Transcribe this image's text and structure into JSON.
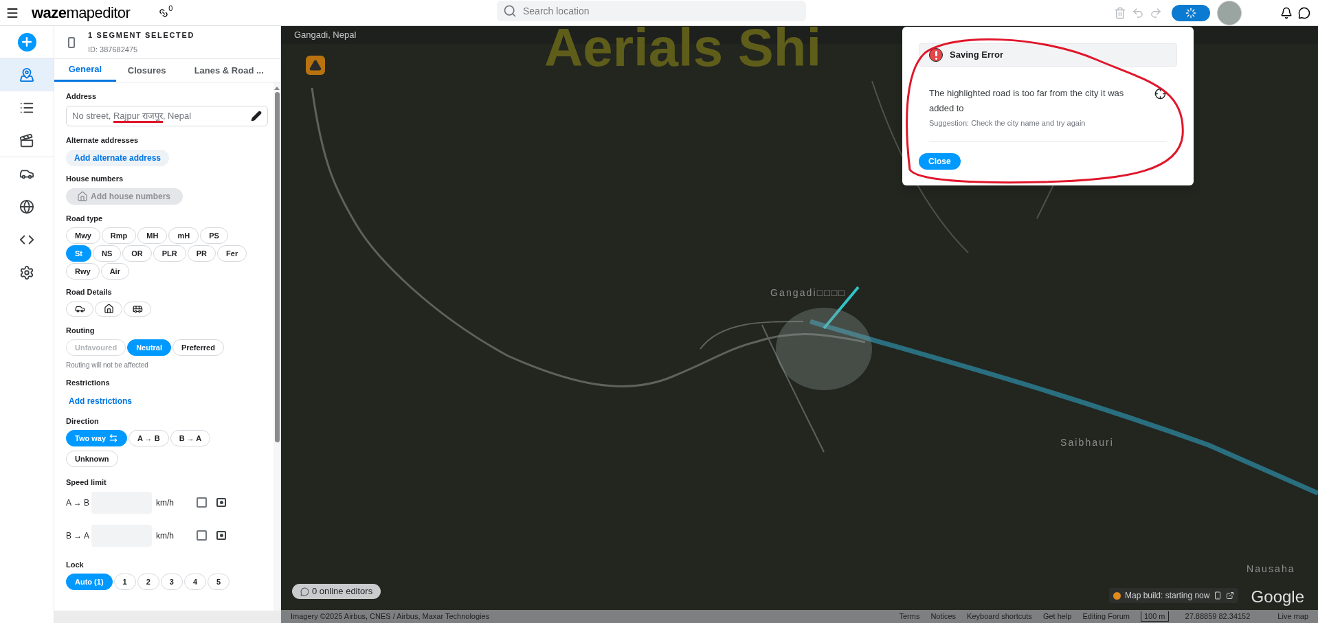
{
  "topbar": {
    "logo_bold": "waze",
    "logo_light": "mapeditor",
    "connections_count": "0",
    "search": {
      "placeholder": "Search location"
    },
    "undo_disabled": true,
    "redo_disabled": true,
    "saving": true
  },
  "rail": [
    {
      "kind": "add",
      "selected": false
    },
    {
      "kind": "edit",
      "selected": true
    },
    {
      "kind": "list",
      "selected": false
    },
    {
      "kind": "events",
      "selected": false
    },
    {
      "kind": "car",
      "selected": false
    },
    {
      "kind": "globe",
      "selected": false
    },
    {
      "kind": "code",
      "selected": false
    },
    {
      "kind": "settings",
      "selected": false
    }
  ],
  "panel": {
    "title": "1 SEGMENT SELECTED",
    "id": "ID: 387682475",
    "tabs": [
      {
        "label": "General",
        "selected": true
      },
      {
        "label": "Closures",
        "selected": false
      },
      {
        "label": "Lanes & Road ...",
        "selected": false
      }
    ],
    "address": {
      "label": "Address",
      "before": "No street, ",
      "city": "Rajpur राजपुर",
      "after": ", Nepal"
    },
    "alternate": {
      "label": "Alternate addresses",
      "button": "Add alternate address"
    },
    "house_numbers": {
      "label": "House numbers",
      "button": "Add house numbers",
      "disabled": true
    },
    "road_type": {
      "label": "Road type",
      "rows": [
        [
          {
            "label": "Mwy",
            "selected": false
          },
          {
            "label": "Rmp",
            "selected": false
          },
          {
            "label": "MH",
            "selected": false
          },
          {
            "label": "mH",
            "selected": false
          },
          {
            "label": "PS",
            "selected": false
          }
        ],
        [
          {
            "label": "St",
            "selected": true
          },
          {
            "label": "NS",
            "selected": false
          },
          {
            "label": "OR",
            "selected": false
          },
          {
            "label": "PLR",
            "selected": false
          },
          {
            "label": "PR",
            "selected": false
          },
          {
            "label": "Fer",
            "selected": false
          }
        ],
        [
          {
            "label": "Rwy",
            "selected": false
          },
          {
            "label": "Air",
            "selected": false
          }
        ]
      ]
    },
    "road_details": {
      "label": "Road Details",
      "items": [
        {
          "kind": "toll",
          "selected": false
        },
        {
          "kind": "tunnel",
          "selected": false
        },
        {
          "kind": "bus",
          "selected": false
        }
      ]
    },
    "routing": {
      "label": "Routing",
      "options": [
        {
          "label": "Unfavoured",
          "selected": false,
          "disabled": true
        },
        {
          "label": "Neutral",
          "selected": true,
          "disabled": false
        },
        {
          "label": "Preferred",
          "selected": false,
          "disabled": false
        }
      ],
      "note": "Routing will not be affected"
    },
    "restrictions": {
      "label": "Restrictions",
      "button": "Add restrictions"
    },
    "direction": {
      "label": "Direction",
      "options": [
        {
          "label": "Two way",
          "kind": "both",
          "selected": true
        },
        {
          "label": "A → B",
          "kind": "plain",
          "selected": false
        },
        {
          "label": "B → A",
          "kind": "plain",
          "selected": false
        },
        {
          "label": "Unknown",
          "kind": "plain",
          "selected": false
        }
      ]
    },
    "speed_limit": {
      "label": "Speed limit",
      "rows": [
        {
          "label": "A → B",
          "unit": "km/h",
          "checked": false
        },
        {
          "label": "B → A",
          "unit": "km/h",
          "checked": false
        }
      ]
    },
    "lock": {
      "label": "Lock",
      "options": [
        {
          "label": "Auto (1)",
          "selected": true
        },
        {
          "label": "1",
          "selected": false
        },
        {
          "label": "2",
          "selected": false
        },
        {
          "label": "3",
          "selected": false
        },
        {
          "label": "4",
          "selected": false
        },
        {
          "label": "5",
          "selected": false
        }
      ]
    }
  },
  "map": {
    "location": "Gangadi, Nepal",
    "overlay": "Aerials Shi",
    "labels": [
      {
        "text": "Gangadi□□□□",
        "kind": "village"
      },
      {
        "text": "Saibhauri",
        "kind": "village"
      },
      {
        "text": "Nausaha",
        "kind": "village"
      }
    ],
    "online_editors": "0 online editors",
    "map_build": "Map build: starting now",
    "google": "Google"
  },
  "dialog": {
    "title": "Saving Error",
    "message": "The highlighted road is too far from the city it was added to",
    "suggestion": "Suggestion: Check the city name and try again",
    "button": "Close"
  },
  "status_bar": {
    "imagery": "Imagery ©2025 Airbus, CNES / Airbus, Maxar Technologies",
    "links": [
      "Terms",
      "Notices",
      "Keyboard shortcuts",
      "Get help",
      "Editing Forum"
    ],
    "scale": "100 m",
    "coords": "27.88859 82.34152",
    "live_map": "Live map"
  }
}
